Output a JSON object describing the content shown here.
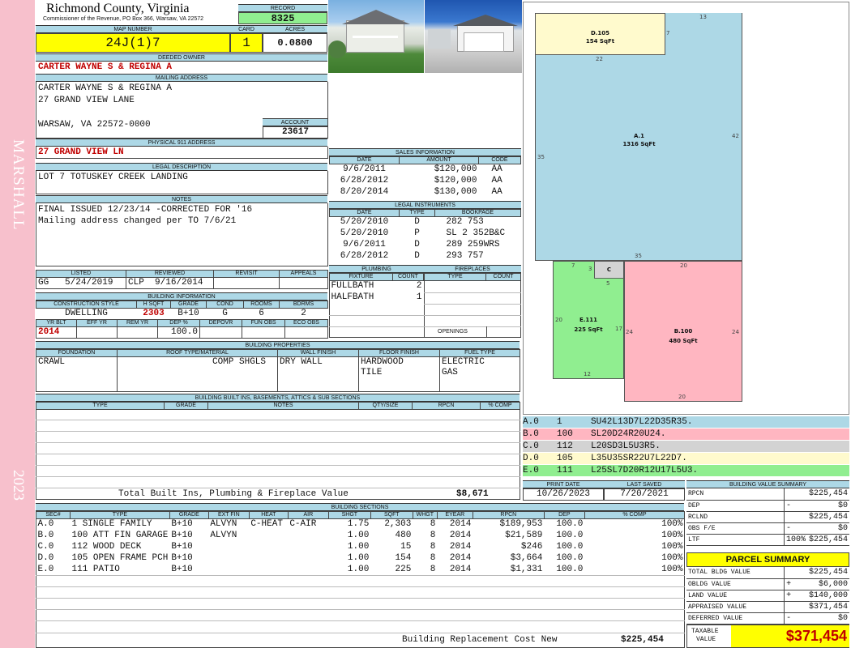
{
  "side": {
    "district": "MARSHALL",
    "year": "2023"
  },
  "header": {
    "county": "Richmond County, Virginia",
    "commissioner": "Commissioner of the Revenue, PO Box 366, Warsaw, VA 22572",
    "record_label": "RECORD",
    "record": "8325",
    "map_label": "MAP NUMBER",
    "map_number": "24J(1)7",
    "card_label": "CARD",
    "card": "1",
    "acres_label": "ACRES",
    "acres": "0.0800"
  },
  "owner": {
    "label": "DEEDED OWNER",
    "name": "CARTER WAYNE S & REGINA A"
  },
  "mailing": {
    "label": "MAILING ADDRESS",
    "line1": "CARTER WAYNE S & REGINA A",
    "line2": "27 GRAND VIEW LANE",
    "line3": "WARSAW, VA 22572-0000"
  },
  "account": {
    "label": "ACCOUNT",
    "value": "23617"
  },
  "physical": {
    "label": "PHYSICAL 911 ADDRESS",
    "value": "27 GRAND VIEW LN"
  },
  "legal": {
    "label": "LEGAL DESCRIPTION",
    "value": "LOT 7 TOTUSKEY CREEK LANDING"
  },
  "notes": {
    "label": "NOTES",
    "line1": "FINAL ISSUED 12/23/14 -CORRECTED FOR '16",
    "line2": "Mailing address changed per TO 7/6/21"
  },
  "sales": {
    "title": "SALES INFORMATION",
    "headers": [
      "DATE",
      "AMOUNT",
      "CODE"
    ],
    "rows": [
      [
        "9/6/2011",
        "$120,000",
        "AA"
      ],
      [
        "6/28/2012",
        "$120,000",
        "AA"
      ],
      [
        "8/20/2014",
        "$130,000",
        "AA"
      ]
    ]
  },
  "instruments": {
    "title": "LEGAL INSTRUMENTS",
    "headers": [
      "DATE",
      "TYPE",
      "BOOKPAGE"
    ],
    "rows": [
      [
        "5/20/2010",
        "D",
        "282 753"
      ],
      [
        "5/20/2010",
        "P",
        "SL 2 352B&C"
      ],
      [
        "9/6/2011",
        "D",
        "289 259WRS"
      ],
      [
        "6/28/2012",
        "D",
        "293 757"
      ]
    ]
  },
  "listing": {
    "headers": [
      "LISTED",
      "REVIEWED",
      "REVISIT",
      "APPEALS"
    ],
    "listed_by": "GG",
    "listed": "5/24/2019",
    "reviewed_by": "CLP",
    "reviewed": "9/16/2014",
    "revisit": "",
    "appeals": ""
  },
  "building_info": {
    "title": "BUILDING INFORMATION",
    "headers1": [
      "CONSTRUCTION STYLE",
      "H SQFT",
      "GRADE",
      "COND",
      "ROOMS",
      "BDRMS"
    ],
    "values1": [
      "DWELLING",
      "2303",
      "B+10",
      "G",
      "6",
      "2"
    ],
    "headers2": [
      "YR BLT",
      "EFF YR",
      "REM YR",
      "DEP %",
      "DEPOVR",
      "FUN OBS",
      "ECO OBS"
    ],
    "values2": [
      "2014",
      "",
      "",
      "100.0",
      "",
      "",
      ""
    ]
  },
  "plumbing": {
    "title": "PLUMBING",
    "headers": [
      "FIXTURE",
      "COUNT"
    ],
    "rows": [
      [
        "FULLBATH",
        "2"
      ],
      [
        "HALFBATH",
        "1"
      ]
    ]
  },
  "fireplaces": {
    "title": "FIREPLACES",
    "headers": [
      "TYPE",
      "COUNT"
    ],
    "openings_label": "OPENINGS"
  },
  "properties": {
    "title": "BUILDING PROPERTIES",
    "headers": [
      "FOUNDATION",
      "ROOF TYPE/MATERIAL",
      "WALL FINISH",
      "FLOOR FINISH",
      "FUEL TYPE"
    ],
    "foundation": "CRAWL",
    "roof": "COMP SHGLS",
    "wall": "DRY WALL",
    "floor1": "HARDWOOD",
    "floor2": "TILE",
    "fuel1": "ELECTRIC",
    "fuel2": "GAS"
  },
  "builtins": {
    "title": "BUILDING BUILT INS, BASEMENTS, ATTICS & SUB SECTIONS",
    "headers": [
      "TYPE",
      "GRADE",
      "NOTES",
      "QTY/SIZE",
      "RPCN",
      "% COMP"
    ],
    "total_label": "Total Built Ins, Plumbing & Fireplace Value",
    "total": "$8,671"
  },
  "sketch": {
    "sections": [
      {
        "label": "D.105",
        "area": "154 SqFt",
        "color": "#fffacd"
      },
      {
        "label": "A.1",
        "area": "1316 SqFt",
        "color": "#add8e6"
      },
      {
        "label": "C",
        "area": "",
        "color": "#d3d3d3"
      },
      {
        "label": "E.111",
        "area": "225 SqFt",
        "color": "#90ee90"
      },
      {
        "label": "B.100",
        "area": "480 SqFt",
        "color": "#ffb6c1"
      }
    ],
    "dims": [
      "13",
      "7",
      "22",
      "35",
      "42",
      "35",
      "7",
      "3",
      "5",
      "20",
      "20",
      "17",
      "24",
      "24",
      "12",
      "20"
    ]
  },
  "legend": [
    {
      "id": "A.0",
      "code": "1",
      "desc": "SU42L13D7L22D35R35.",
      "color": "#add8e6"
    },
    {
      "id": "B.0",
      "code": "100",
      "desc": "SL20D24R20U24.",
      "color": "#ffb6c1"
    },
    {
      "id": "C.0",
      "code": "112",
      "desc": "L20SD3L5U3R5.",
      "color": "#d3d3d3"
    },
    {
      "id": "D.0",
      "code": "105",
      "desc": "L35U35SR22U7L22D7.",
      "color": "#fffacd"
    },
    {
      "id": "E.0",
      "code": "111",
      "desc": "L25SL7D20R12U17L5U3.",
      "color": "#90ee90"
    }
  ],
  "dates": {
    "print_label": "PRINT DATE",
    "print": "10/26/2023",
    "saved_label": "LAST SAVED",
    "saved": "7/20/2021"
  },
  "sections": {
    "title": "BUILDING SECTIONS",
    "headers": [
      "SEC#",
      "TYPE",
      "GRADE",
      "EXT FIN",
      "HEAT",
      "AIR",
      "SHGT",
      "SQFT",
      "WHGT",
      "EYEAR",
      "RPCN",
      "DEP",
      "% COMP"
    ],
    "rows": [
      [
        "A.0",
        "1 SINGLE FAMILY",
        "B+10",
        "ALVYN",
        "C-HEAT",
        "C-AIR",
        "1.75",
        "2,303",
        "8",
        "2014",
        "$189,953",
        "100.0",
        "100%"
      ],
      [
        "B.0",
        "100 ATT FIN GARAGE",
        "B+10",
        "ALVYN",
        "",
        "",
        "1.00",
        "480",
        "8",
        "2014",
        "$21,589",
        "100.0",
        "100%"
      ],
      [
        "C.0",
        "112 WOOD DECK",
        "B+10",
        "",
        "",
        "",
        "1.00",
        "15",
        "8",
        "2014",
        "$246",
        "100.0",
        "100%"
      ],
      [
        "D.0",
        "105 OPEN FRAME PCH",
        "B+10",
        "",
        "",
        "",
        "1.00",
        "154",
        "8",
        "2014",
        "$3,664",
        "100.0",
        "100%"
      ],
      [
        "E.0",
        "111 PATIO",
        "B+10",
        "",
        "",
        "",
        "1.00",
        "225",
        "8",
        "2014",
        "$1,331",
        "100.0",
        "100%"
      ]
    ],
    "total_label": "Building Replacement Cost New",
    "total": "$225,454"
  },
  "value_summary": {
    "title": "BUILDING VALUE SUMMARY",
    "rows": [
      {
        "label": "RPCN",
        "sign": "",
        "value": "$225,454"
      },
      {
        "label": "DEP",
        "sign": "-",
        "value": "$0"
      },
      {
        "label": "RCLND",
        "sign": "",
        "value": "$225,454"
      },
      {
        "label": "OBS F/E",
        "sign": "-",
        "value": "$0"
      },
      {
        "label": "LTF",
        "sign": "100%",
        "value": "$225,454"
      }
    ]
  },
  "parcel": {
    "title": "PARCEL SUMMARY",
    "rows": [
      {
        "label": "TOTAL BLDG VALUE",
        "sign": "",
        "value": "$225,454"
      },
      {
        "label": "OBLDG VALUE",
        "sign": "+",
        "value": "$6,000"
      },
      {
        "label": "LAND VALUE",
        "sign": "+",
        "value": "$140,000"
      },
      {
        "label": "APPRAISED VALUE",
        "sign": "",
        "value": "$371,454"
      },
      {
        "label": "DEFERRED VALUE",
        "sign": "-",
        "value": "$0"
      }
    ],
    "taxable_label1": "TAXABLE",
    "taxable_label2": "VALUE",
    "taxable": "$371,454"
  }
}
